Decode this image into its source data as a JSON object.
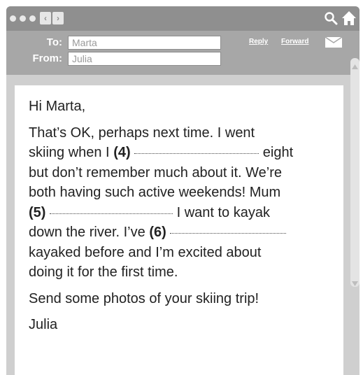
{
  "header": {
    "to_label": "To:",
    "to_value": "Marta",
    "from_label": "From:",
    "from_value": "Julia",
    "reply_label": "Reply",
    "forward_label": "Forward"
  },
  "toolbar": {
    "back_glyph": "‹",
    "forward_glyph": "›",
    "icons": [
      "search-icon",
      "home-icon",
      "envelope-icon"
    ]
  },
  "message": {
    "greeting": "Hi Marta,",
    "body": [
      "That’s OK, perhaps next time. I went",
      "skiing when I",
      "(4)",
      "eight",
      "but don’t remember much about it. We’re",
      "both having such active weekends! Mum",
      "(5)",
      "I want to kayak",
      "down the river. I’ve",
      "(6)",
      "kayaked before and I’m excited about",
      "doing it for the first time."
    ],
    "closing_line": "Send some photos of your skiing trip!",
    "signature": "Julia"
  },
  "colors": {
    "topbar": "#8f8f8f",
    "header": "#a7a7a7",
    "frame": "#cfcfcf"
  }
}
